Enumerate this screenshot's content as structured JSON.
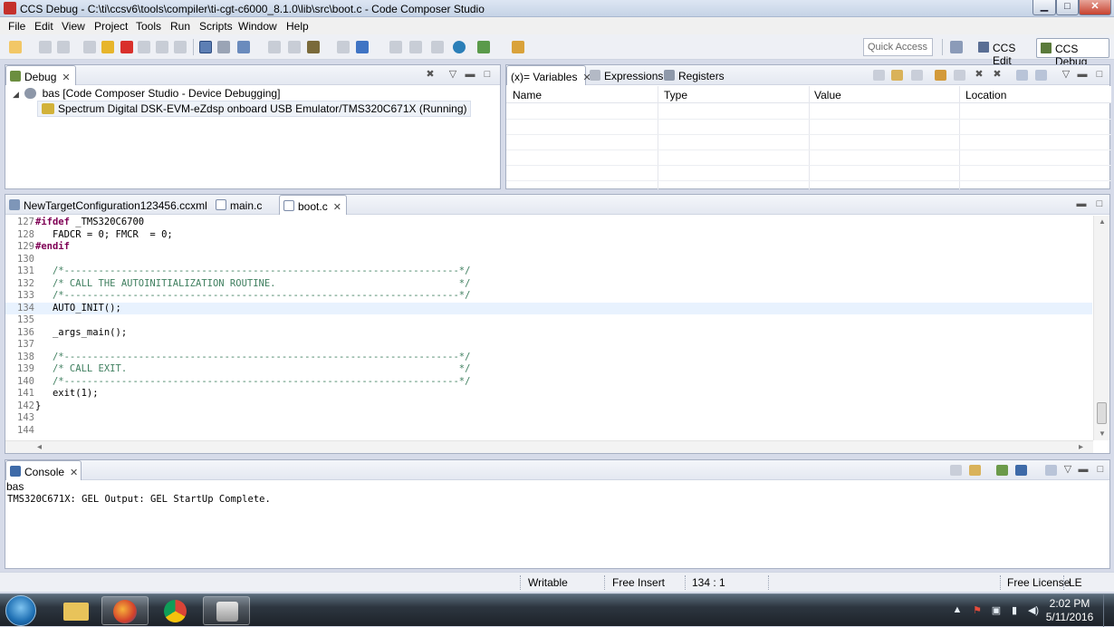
{
  "window": {
    "title": "CCS Debug - C:\\ti\\ccsv6\\tools\\compiler\\ti-cgt-c6000_8.1.0\\lib\\src\\boot.c - Code Composer Studio",
    "min": "▁",
    "max": "□",
    "close": "✕"
  },
  "menu": [
    "File",
    "Edit",
    "View",
    "Project",
    "Tools",
    "Run",
    "Scripts",
    "Window",
    "Help"
  ],
  "toolbar": {
    "quick_access": "Quick Access",
    "persp_edit": "CCS Edit",
    "persp_debug": "CCS Debug"
  },
  "debug_view": {
    "tab": "Debug",
    "session": "bas [Code Composer Studio - Device Debugging]",
    "target": "Spectrum Digital DSK-EVM-eZdsp onboard USB Emulator/TMS320C671X (Running)"
  },
  "variables_view": {
    "tabs": [
      "(x)= Variables",
      "Expressions",
      "Registers"
    ],
    "columns": [
      "Name",
      "Type",
      "Value",
      "Location"
    ]
  },
  "editor": {
    "tabs": [
      "NewTargetConfiguration123456.ccxml",
      "main.c",
      "boot.c"
    ],
    "lines": [
      {
        "n": "127",
        "kw": "#ifdef",
        "rest": " _TMS320C6700",
        "cm": ""
      },
      {
        "n": "128",
        "kw": "",
        "rest": "   FADCR = 0; FMCR  = 0;",
        "cm": ""
      },
      {
        "n": "129",
        "kw": "#endif",
        "rest": "",
        "cm": ""
      },
      {
        "n": "130",
        "kw": "",
        "rest": "",
        "cm": ""
      },
      {
        "n": "131",
        "kw": "",
        "rest": "   ",
        "cm": "/*---------------------------------------------------------------------*/"
      },
      {
        "n": "132",
        "kw": "",
        "rest": "   ",
        "cm": "/* CALL THE AUTOINITIALIZATION ROUTINE.                                */"
      },
      {
        "n": "133",
        "kw": "",
        "rest": "   ",
        "cm": "/*---------------------------------------------------------------------*/"
      },
      {
        "n": "134",
        "kw": "",
        "rest": "   AUTO_INIT();",
        "cm": ""
      },
      {
        "n": "135",
        "kw": "",
        "rest": "",
        "cm": ""
      },
      {
        "n": "136",
        "kw": "",
        "rest": "   _args_main();",
        "cm": ""
      },
      {
        "n": "137",
        "kw": "",
        "rest": "",
        "cm": ""
      },
      {
        "n": "138",
        "kw": "",
        "rest": "   ",
        "cm": "/*---------------------------------------------------------------------*/"
      },
      {
        "n": "139",
        "kw": "",
        "rest": "   ",
        "cm": "/* CALL EXIT.                                                          */"
      },
      {
        "n": "140",
        "kw": "",
        "rest": "   ",
        "cm": "/*---------------------------------------------------------------------*/"
      },
      {
        "n": "141",
        "kw": "",
        "rest": "   exit(1);",
        "cm": ""
      },
      {
        "n": "142",
        "kw": "",
        "rest": "}",
        "cm": ""
      },
      {
        "n": "143",
        "kw": "",
        "rest": "",
        "cm": ""
      },
      {
        "n": "144",
        "kw": "",
        "rest": "",
        "cm": ""
      }
    ],
    "highlight_line": "134"
  },
  "console": {
    "tab": "Console",
    "name": "bas",
    "output": "TMS320C671X: GEL Output: GEL StartUp Complete."
  },
  "status": {
    "writable": "Writable",
    "insert": "Free Insert",
    "position": "134 : 1",
    "license": "Free License",
    "le": "LE"
  },
  "taskbar": {
    "time": "2:02 PM",
    "date": "5/11/2016"
  }
}
